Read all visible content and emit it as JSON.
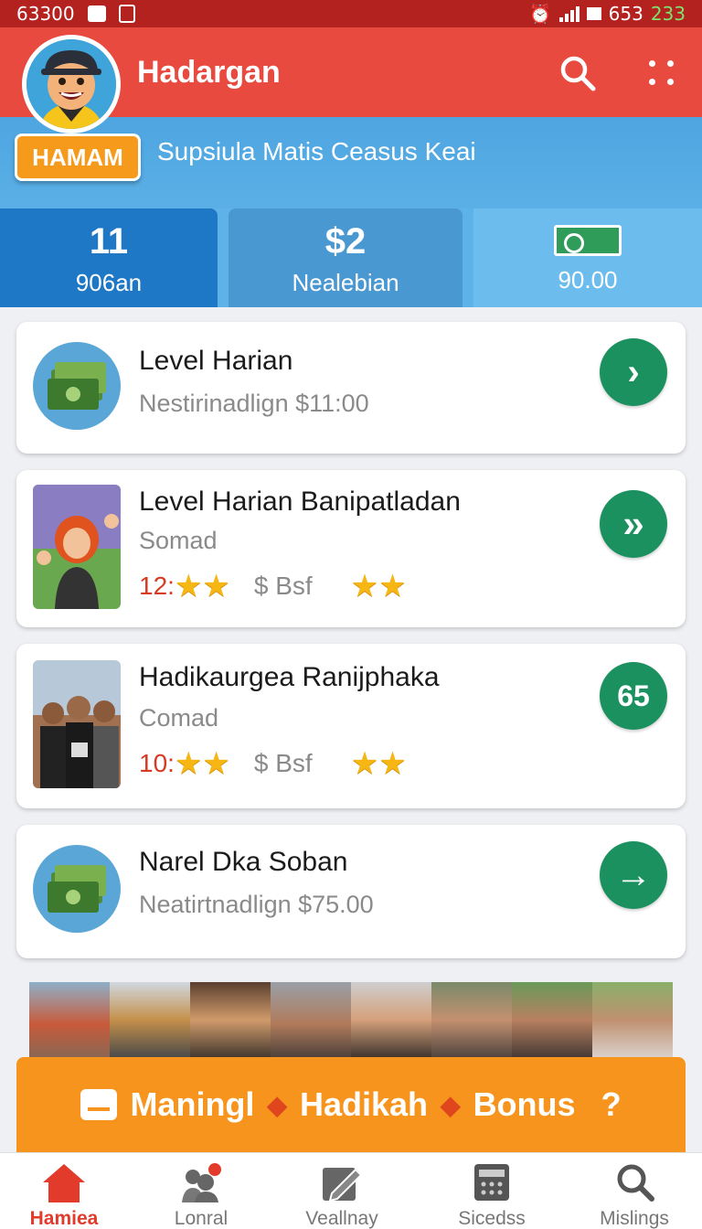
{
  "status_bar": {
    "time": "63300",
    "right_text": "653",
    "right_accent": "233"
  },
  "app_bar": {
    "title": "Hadargan",
    "search_icon": "search-icon",
    "more_icon": "more-icon"
  },
  "banner": {
    "badge": "HAMAM",
    "text": "Supsiula Matis Ceasus Keai"
  },
  "stats": [
    {
      "value": "11",
      "label": "906an"
    },
    {
      "value": "$2",
      "label": "Nealebian"
    },
    {
      "value": "",
      "label": "90.00",
      "icon": "money-icon"
    }
  ],
  "cards": [
    {
      "title": "Level Harian",
      "subtitle": "Nestirinadlign $11:00",
      "button": "›",
      "thumb": "money-stack"
    },
    {
      "title": "Level Harian Banipatladan",
      "subtitle": "Somad",
      "rating": "12:",
      "price": "$ Bsf",
      "button": "»",
      "thumb": "person-illustration"
    },
    {
      "title": "Hadikaurgea Ranijphaka",
      "subtitle": "Comad",
      "rating": "10:",
      "price": "$ Bsf",
      "button": "65",
      "thumb": "group-photo"
    },
    {
      "title": "Narel Dka Soban",
      "subtitle": "Neatirtnadlign $75.00",
      "button": "→",
      "thumb": "money-stack"
    }
  ],
  "bonus_bar": {
    "part1": "Maningl",
    "part2": "Hadikah",
    "part3": "Bonus",
    "question": "?"
  },
  "bottom_nav": [
    {
      "label": "Hamiea",
      "icon": "home-icon",
      "active": true
    },
    {
      "label": "Lonral",
      "icon": "people-icon",
      "active": false
    },
    {
      "label": "Veallnay",
      "icon": "edit-icon",
      "active": false
    },
    {
      "label": "Sicedss",
      "icon": "calculator-icon",
      "active": false
    },
    {
      "label": "Mislings",
      "icon": "search-icon",
      "active": false
    }
  ],
  "colors": {
    "primary_red": "#e84a3f",
    "banner_blue": "#4ea5e0",
    "accent_orange": "#f7941d",
    "button_green": "#1c9160"
  }
}
